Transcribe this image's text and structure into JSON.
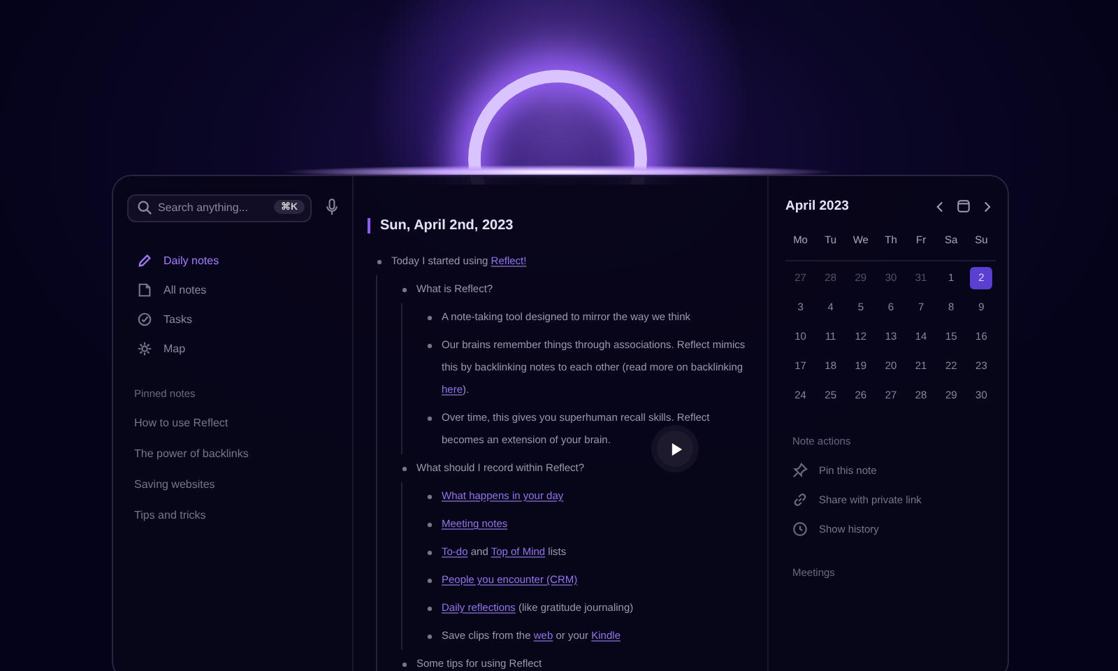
{
  "search": {
    "placeholder": "Search anything...",
    "shortcut": "⌘K"
  },
  "nav": [
    {
      "label": "Daily notes",
      "selected": true
    },
    {
      "label": "All notes",
      "selected": false
    },
    {
      "label": "Tasks",
      "selected": false
    },
    {
      "label": "Map",
      "selected": false
    }
  ],
  "pinned": {
    "heading": "Pinned notes",
    "items": [
      "How to use Reflect",
      "The power of backlinks",
      "Saving websites",
      "Tips and tricks"
    ]
  },
  "note": {
    "title": "Sun, April 2nd, 2023",
    "items": [
      {
        "parts": [
          {
            "text": "Today I started using ",
            "link": false
          },
          {
            "text": "Reflect!",
            "link": true
          }
        ],
        "children": [
          {
            "parts": [
              {
                "text": "What is Reflect?",
                "link": false
              }
            ],
            "children": [
              {
                "parts": [
                  {
                    "text": "A note-taking tool designed to mirror the way we think",
                    "link": false
                  }
                ]
              },
              {
                "parts": [
                  {
                    "text": "Our brains remember things through associations. Reflect mimics this by backlinking notes to each other (read more on backlinking ",
                    "link": false
                  },
                  {
                    "text": "here",
                    "link": true
                  },
                  {
                    "text": ").",
                    "link": false
                  }
                ]
              },
              {
                "parts": [
                  {
                    "text": "Over time, this gives you superhuman recall skills. Reflect becomes an extension of your brain.",
                    "link": false
                  }
                ]
              }
            ]
          },
          {
            "parts": [
              {
                "text": "What should I record within Reflect?",
                "link": false
              }
            ],
            "children": [
              {
                "parts": [
                  {
                    "text": "What happens in your day",
                    "link": true
                  }
                ]
              },
              {
                "parts": [
                  {
                    "text": "Meeting notes",
                    "link": true
                  }
                ]
              },
              {
                "parts": [
                  {
                    "text": "To-do",
                    "link": true
                  },
                  {
                    "text": " and ",
                    "link": false
                  },
                  {
                    "text": "Top of Mind",
                    "link": true
                  },
                  {
                    "text": " lists",
                    "link": false
                  }
                ]
              },
              {
                "parts": [
                  {
                    "text": "People you encounter (CRM)",
                    "link": true
                  }
                ]
              },
              {
                "parts": [
                  {
                    "text": "Daily reflections",
                    "link": true
                  },
                  {
                    "text": " (like gratitude journaling)",
                    "link": false
                  }
                ]
              },
              {
                "parts": [
                  {
                    "text": "Save clips from the ",
                    "link": false
                  },
                  {
                    "text": "web",
                    "link": true
                  },
                  {
                    "text": " or your ",
                    "link": false
                  },
                  {
                    "text": "Kindle",
                    "link": true
                  }
                ]
              }
            ]
          },
          {
            "parts": [
              {
                "text": "Some tips for using Reflect",
                "link": false
              }
            ]
          }
        ]
      }
    ]
  },
  "calendar": {
    "title": "April 2023",
    "weekdays": [
      "Mo",
      "Tu",
      "We",
      "Th",
      "Fr",
      "Sa",
      "Su"
    ],
    "days": [
      {
        "label": "27",
        "muted": true,
        "selected": false
      },
      {
        "label": "28",
        "muted": true,
        "selected": false
      },
      {
        "label": "29",
        "muted": true,
        "selected": false
      },
      {
        "label": "30",
        "muted": true,
        "selected": false
      },
      {
        "label": "31",
        "muted": true,
        "selected": false
      },
      {
        "label": "1",
        "muted": false,
        "selected": false
      },
      {
        "label": "2",
        "muted": false,
        "selected": true
      },
      {
        "label": "3",
        "muted": false,
        "selected": false
      },
      {
        "label": "4",
        "muted": false,
        "selected": false
      },
      {
        "label": "5",
        "muted": false,
        "selected": false
      },
      {
        "label": "6",
        "muted": false,
        "selected": false
      },
      {
        "label": "7",
        "muted": false,
        "selected": false
      },
      {
        "label": "8",
        "muted": false,
        "selected": false
      },
      {
        "label": "9",
        "muted": false,
        "selected": false
      },
      {
        "label": "10",
        "muted": false,
        "selected": false
      },
      {
        "label": "11",
        "muted": false,
        "selected": false
      },
      {
        "label": "12",
        "muted": false,
        "selected": false
      },
      {
        "label": "13",
        "muted": false,
        "selected": false
      },
      {
        "label": "14",
        "muted": false,
        "selected": false
      },
      {
        "label": "15",
        "muted": false,
        "selected": false
      },
      {
        "label": "16",
        "muted": false,
        "selected": false
      },
      {
        "label": "17",
        "muted": false,
        "selected": false
      },
      {
        "label": "18",
        "muted": false,
        "selected": false
      },
      {
        "label": "19",
        "muted": false,
        "selected": false
      },
      {
        "label": "20",
        "muted": false,
        "selected": false
      },
      {
        "label": "21",
        "muted": false,
        "selected": false
      },
      {
        "label": "22",
        "muted": false,
        "selected": false
      },
      {
        "label": "23",
        "muted": false,
        "selected": false
      },
      {
        "label": "24",
        "muted": false,
        "selected": false
      },
      {
        "label": "25",
        "muted": false,
        "selected": false
      },
      {
        "label": "26",
        "muted": false,
        "selected": false
      },
      {
        "label": "27",
        "muted": false,
        "selected": false
      },
      {
        "label": "28",
        "muted": false,
        "selected": false
      },
      {
        "label": "29",
        "muted": false,
        "selected": false
      },
      {
        "label": "30",
        "muted": false,
        "selected": false
      }
    ]
  },
  "actions": {
    "heading": "Note actions",
    "items": [
      "Pin this note",
      "Share with private link",
      "Show history"
    ]
  },
  "meetings": {
    "heading": "Meetings"
  }
}
